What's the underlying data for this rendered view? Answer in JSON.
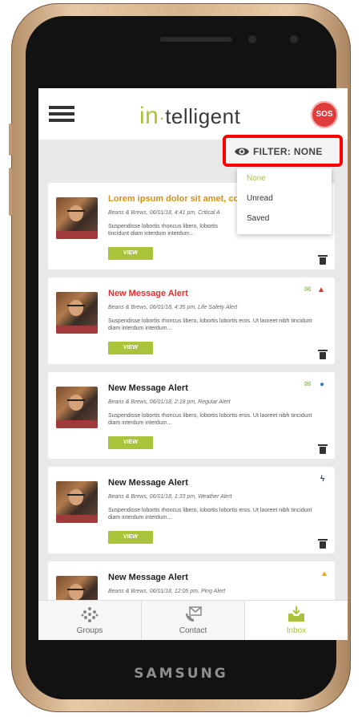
{
  "device": {
    "brand": "SAMSUNG"
  },
  "header": {
    "menu_icon": "hamburger-icon",
    "logo_in": "in",
    "logo_dot": "·",
    "logo_rest": "telligent",
    "sos_label": "SOS",
    "sos_color": "#e23b3b"
  },
  "filter": {
    "label": "FILTER: NONE",
    "icon": "eye-icon",
    "options": [
      "None",
      "Unread",
      "Saved"
    ],
    "selected": "None"
  },
  "messages": [
    {
      "title": "Lorem ipsum dolor sit amet, co",
      "meta": "Beans & Brews, 06/01/18, 4:41 pm, Critical A",
      "body": "Suspendisse lobortis rhoncus libero, lobortis tincidunt diam interdum interdum...",
      "view_label": "VIEW",
      "status_icons": []
    },
    {
      "title": "New Message Alert",
      "meta": "Beans & Brews, 06/01/18, 4:35 pm, Life Safety Alert",
      "body": "Suspendisse lobortis rhoncus libero, lobortis lobortis eros. Ut laoreet nibh tincidunt diam interdum interdum...",
      "view_label": "VIEW",
      "status_icons": [
        "envelope-icon",
        "warning-icon"
      ]
    },
    {
      "title": "New Message Alert",
      "meta": "Beans & Brews, 06/01/18, 2:18 pm, Regular Alert",
      "body": "Suspendisse lobortis rhoncus libero, lobortis lobortis eros. Ut laoreet nibh tincidunt diam interdum interdum...",
      "view_label": "VIEW",
      "status_icons": [
        "envelope-icon",
        "dot-icon"
      ]
    },
    {
      "title": "New Message Alert",
      "meta": "Beans & Brews, 06/01/18, 1:33 pm, Weather Alert",
      "body": "Suspendisse lobortis rhoncus libero, lobortis lobortis eros. Ut laoreet nibh tincidunt diam interdum interdum...",
      "view_label": "VIEW",
      "status_icons": [
        "lightning-icon"
      ]
    },
    {
      "title": "New Message Alert",
      "meta": "Beans & Brews, 06/01/18, 12:05 pm, Ping Alert",
      "status_icons": [
        "bell-icon"
      ]
    }
  ],
  "bottom_nav": {
    "items": [
      {
        "label": "Groups",
        "icon": "groups-icon"
      },
      {
        "label": "Contact",
        "icon": "contact-icon"
      },
      {
        "label": "Inbox",
        "icon": "inbox-icon",
        "active": true
      }
    ]
  },
  "colors": {
    "accent": "#a9c33a",
    "alert_red": "#e13030",
    "alert_orange": "#d4931a",
    "highlight_border": "#ff0000"
  }
}
